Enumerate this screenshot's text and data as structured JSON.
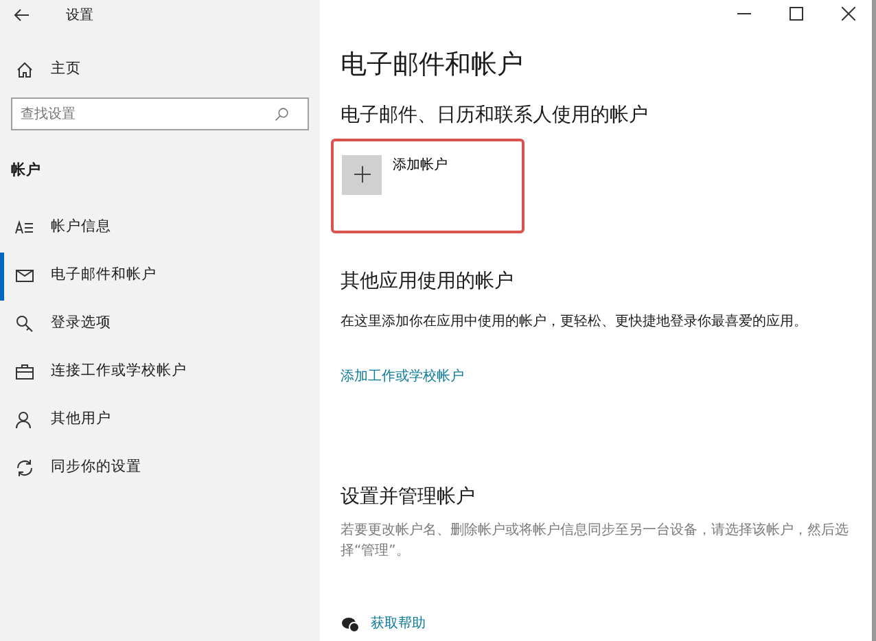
{
  "window": {
    "title": "设置"
  },
  "sidebar": {
    "home": "主页",
    "search": {
      "placeholder": "查找设置"
    },
    "section": "帐户",
    "items": [
      {
        "kind": "info",
        "label": "帐户信息",
        "selected": false
      },
      {
        "kind": "mail",
        "label": "电子邮件和帐户",
        "selected": true
      },
      {
        "kind": "key",
        "label": "登录选项",
        "selected": false
      },
      {
        "kind": "briefcase",
        "label": "连接工作或学校帐户",
        "selected": false
      },
      {
        "kind": "person",
        "label": "其他用户",
        "selected": false
      },
      {
        "kind": "sync",
        "label": "同步你的设置",
        "selected": false
      }
    ]
  },
  "main": {
    "title": "电子邮件和帐户",
    "section1": {
      "heading": "电子邮件、日历和联系人使用的帐户",
      "add_button": "添加帐户",
      "highlighted": true
    },
    "section2": {
      "heading": "其他应用使用的帐户",
      "text": "在这里添加你在应用中使用的帐户，更轻松、更快捷地登录你最喜爱的应用。",
      "link": "添加工作或学校帐户"
    },
    "section3": {
      "heading": "设置并管理帐户",
      "text": "若要更改帐户名、删除帐户或将帐户信息同步至另一台设备，请选择该帐户，然后选择“管理”。"
    },
    "help": "获取帮助"
  }
}
